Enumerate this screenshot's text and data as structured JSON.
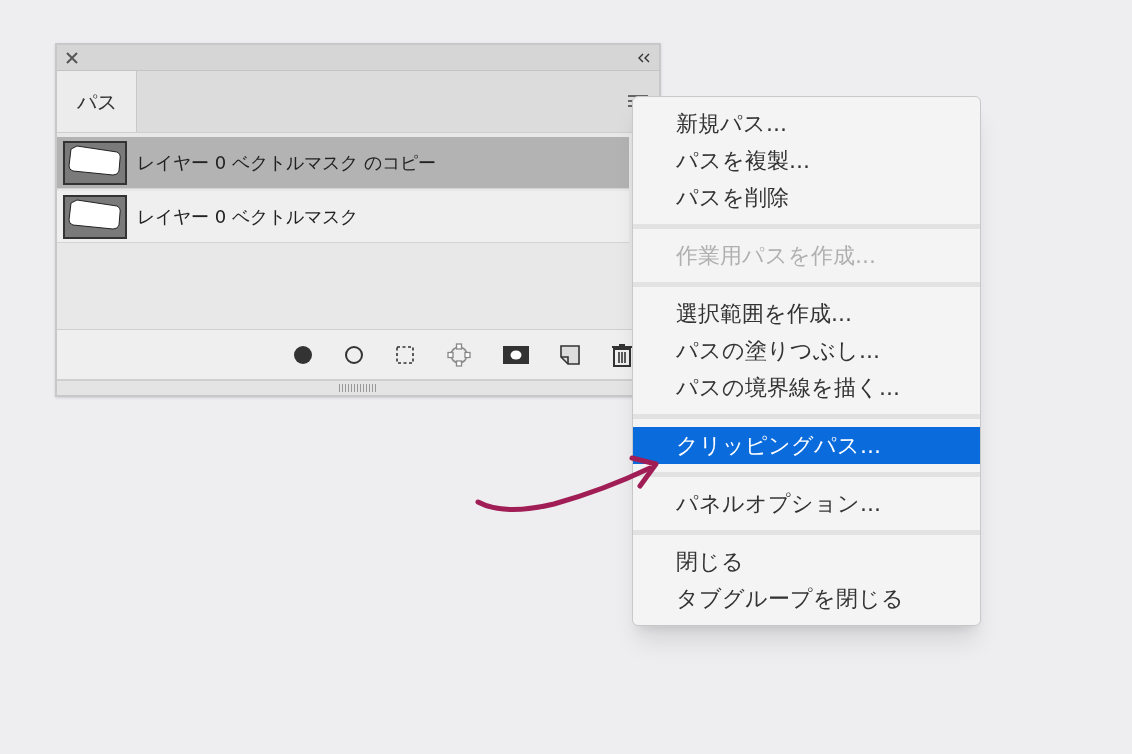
{
  "panel": {
    "tabs": [
      {
        "label": "パス",
        "selected": true
      }
    ],
    "paths": [
      {
        "name": "レイヤー 0 ベクトルマスク のコピー",
        "selected": true
      },
      {
        "name": "レイヤー 0 ベクトルマスク",
        "selected": false
      }
    ]
  },
  "menu": {
    "groups": [
      {
        "items": [
          {
            "label": "新規パス...",
            "disabled": false,
            "selected": false
          },
          {
            "label": "パスを複製...",
            "disabled": false,
            "selected": false
          },
          {
            "label": "パスを削除",
            "disabled": false,
            "selected": false
          }
        ]
      },
      {
        "items": [
          {
            "label": "作業用パスを作成...",
            "disabled": true,
            "selected": false
          }
        ]
      },
      {
        "items": [
          {
            "label": "選択範囲を作成...",
            "disabled": false,
            "selected": false
          },
          {
            "label": "パスの塗りつぶし...",
            "disabled": false,
            "selected": false
          },
          {
            "label": "パスの境界線を描く...",
            "disabled": false,
            "selected": false
          }
        ]
      },
      {
        "items": [
          {
            "label": "クリッピングパス...",
            "disabled": false,
            "selected": true
          }
        ]
      },
      {
        "items": [
          {
            "label": "パネルオプション...",
            "disabled": false,
            "selected": false
          }
        ]
      },
      {
        "items": [
          {
            "label": "閉じる",
            "disabled": false,
            "selected": false
          },
          {
            "label": "タブグループを閉じる",
            "disabled": false,
            "selected": false
          }
        ]
      }
    ]
  }
}
